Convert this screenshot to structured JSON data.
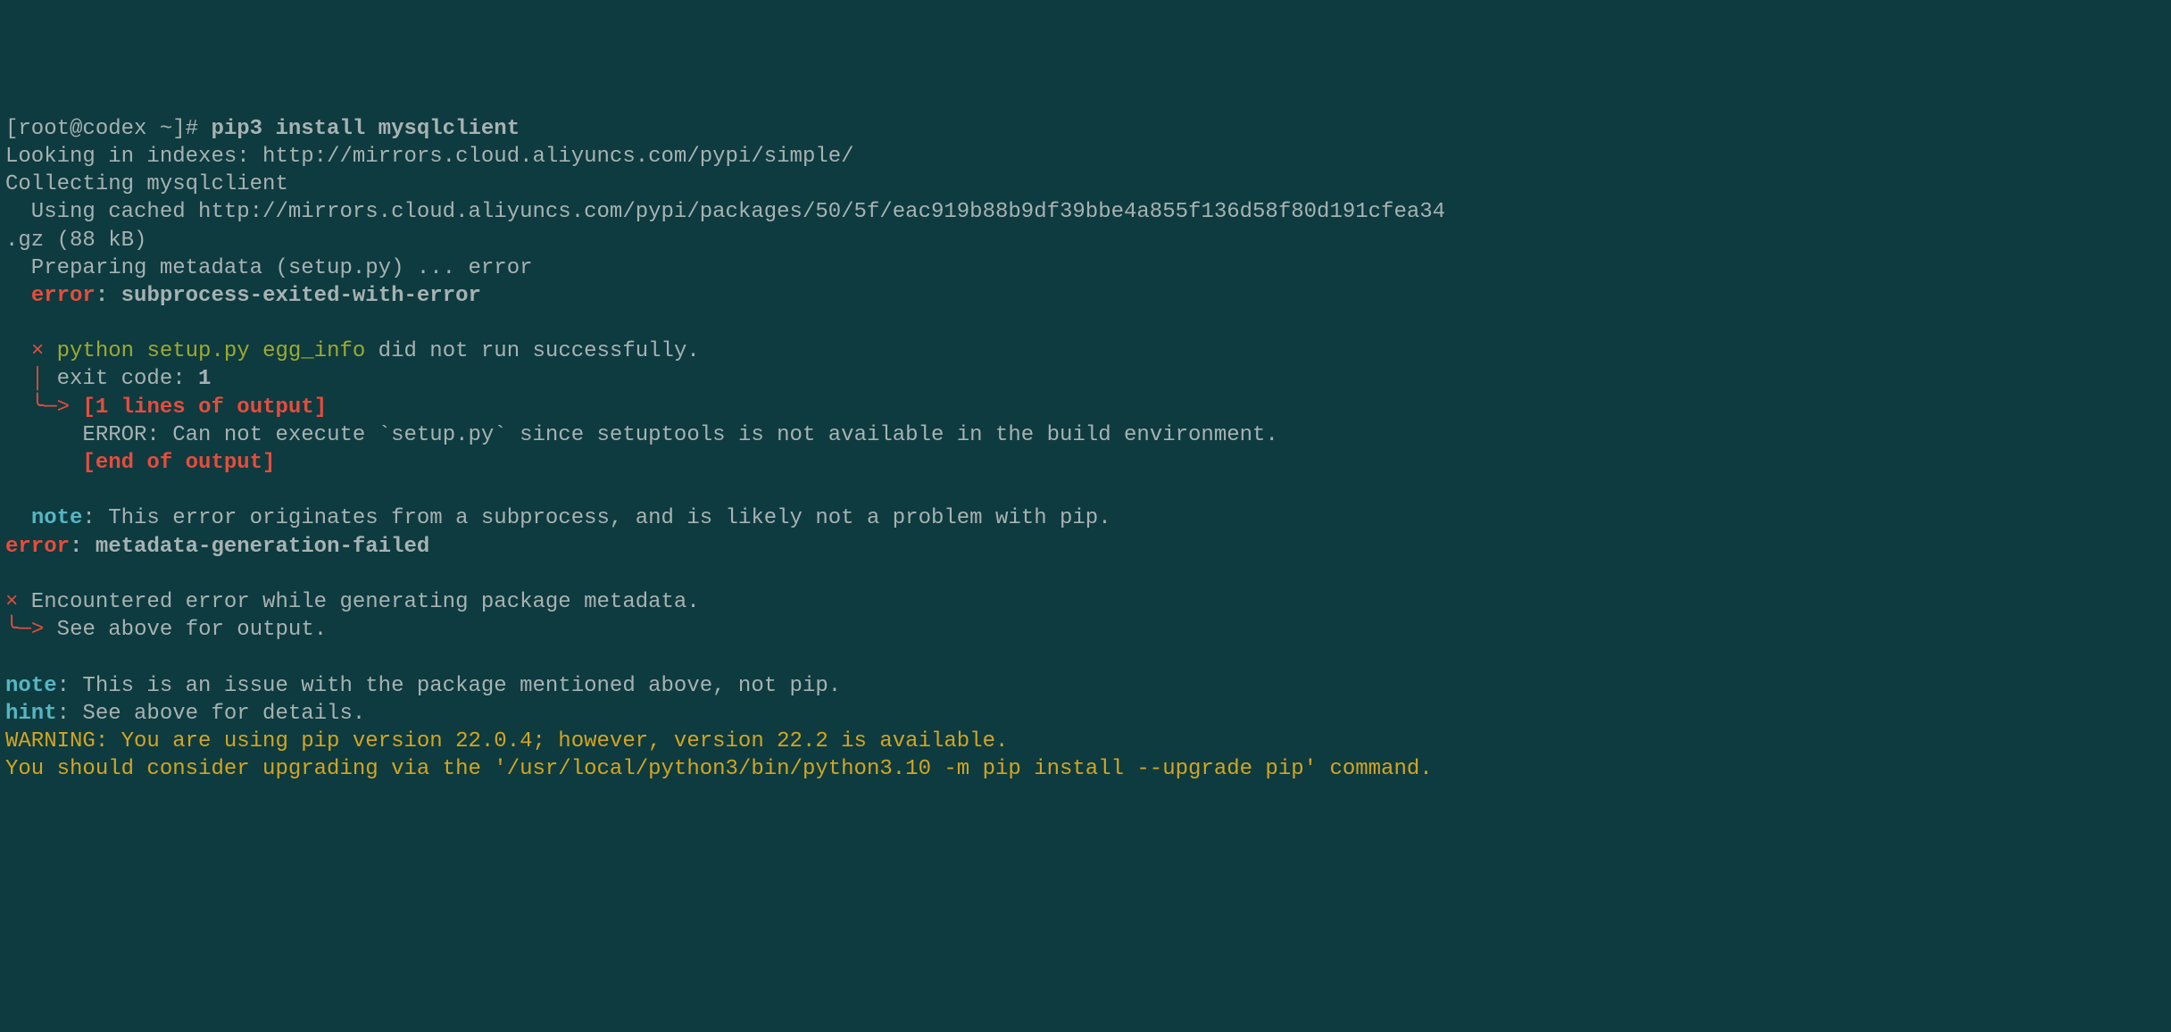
{
  "prompt": {
    "user_host": "[root@codex ~]# ",
    "command": "pip3 install mysqlclient"
  },
  "lines": {
    "looking": "Looking in indexes: http://mirrors.cloud.aliyuncs.com/pypi/simple/",
    "collecting": "Collecting mysqlclient",
    "cached": "  Using cached http://mirrors.cloud.aliyuncs.com/pypi/packages/50/5f/eac919b88b9df39bbe4a855f136d58f80d191cfea34",
    "gz": ".gz (88 kB)",
    "preparing": "  Preparing metadata (setup.py) ... error",
    "indent2": "  ",
    "error1_label": "error",
    "colon_sp": ": ",
    "error1_msg": "subprocess-exited-with-error",
    "blank": "  ",
    "cross": "×",
    "sp": " ",
    "setup_olive": "python setup.py egg_info",
    "setup_rest": " did not run successfully.",
    "pipe": "  │ ",
    "exit_label": "exit code: ",
    "exit_code": "1",
    "elbow": "  ╰─>",
    "lines_output": " [1 lines of output]",
    "indent6": "      ",
    "setuptools_err": "ERROR: Can not execute `setup.py` since setuptools is not available in the build environment.",
    "end_output": "[end of output]",
    "note1_label": "note",
    "note1_msg": ": This error originates from a subprocess, and is likely not a problem with pip.",
    "error2_label": "error",
    "error2_msg": "metadata-generation-failed",
    "encountered": " Encountered error while generating package metadata.",
    "elbow0": "╰─>",
    "see_above": " See above for output.",
    "note2_label": "note",
    "note2_msg": ": This is an issue with the package mentioned above, not pip.",
    "hint_label": "hint",
    "hint_msg": ": See above for details.",
    "warning1": "WARNING: You are using pip version 22.0.4; however, version 22.2 is available.",
    "warning2": "You should consider upgrading via the '/usr/local/python3/bin/python3.10 -m pip install --upgrade pip' command."
  }
}
